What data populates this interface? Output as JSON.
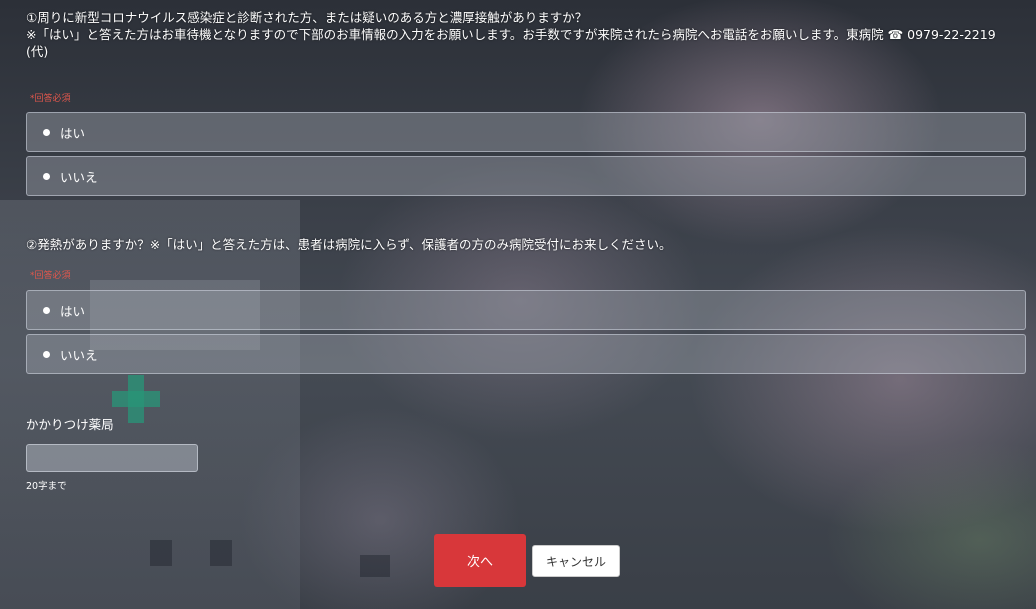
{
  "questions": [
    {
      "line1": "①周りに新型コロナウイルス感染症と診断された方、または疑いのある方と濃厚接触がありますか？",
      "line2": "※「はい」と答えた方はお車待機となりますので下部のお車情報の入力をお願いします。お手数ですが来院されたら病院へお電話をお願いします。東病院 ☎ 0979-22-2219",
      "line3": "(代)",
      "required": "*回答必須",
      "options": [
        {
          "label": "はい"
        },
        {
          "label": "いいえ"
        }
      ]
    },
    {
      "line1": "②発熱がありますか？※「はい」と答えた方は、患者は病院に入らず、保護者の方のみ病院受付にお来しください。",
      "required": "*回答必須",
      "options": [
        {
          "label": "はい"
        },
        {
          "label": "いいえ"
        }
      ]
    }
  ],
  "pharmacy": {
    "label": "かかりつけ薬局",
    "value": "",
    "hint": "20字まで"
  },
  "buttons": {
    "next": "次へ",
    "cancel": "キャンセル"
  },
  "colors": {
    "next_button": "#d8373a",
    "required_text": "#e2574c"
  }
}
